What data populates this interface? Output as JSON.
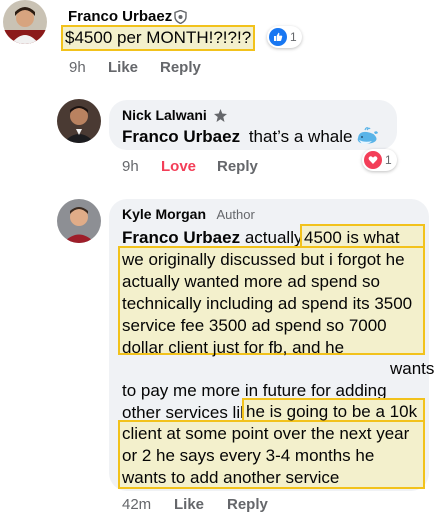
{
  "comments": [
    {
      "author": "Franco Urbaez",
      "text": "$4500 per MONTH!?!?!?",
      "reaction_count": "1",
      "time": "9h",
      "like_label": "Like",
      "reply_label": "Reply"
    },
    {
      "author": "Nick Lalwani",
      "mention": "Franco Urbaez",
      "text": "that’s a whale",
      "reaction_count": "1",
      "time": "9h",
      "like_label": "Love",
      "reply_label": "Reply"
    },
    {
      "author": "Kyle Morgan",
      "badge": "Author",
      "mention": "Franco Urbaez",
      "text_part1": "actually",
      "text_part2": "4500 is what we originally discussed but i forgot he actually wanted more ad spend so technically including ad spend its 3500 service fee 3500 ad spend so 7000 dollar client just for fb, and he",
      "text_part3": "wants to pay me more in future for adding other services like snapchat ads and stuff....",
      "text_part4": "he is going to be a 10k client at some point over the next year or 2 he says every 3-4 months he wants to add another service",
      "time": "42m",
      "like_label": "Like",
      "reply_label": "Reply"
    }
  ],
  "colors": {
    "like_blue": "#1877f2",
    "love_red": "#f33e58",
    "highlight_outline": "#f2c21b",
    "highlight_fill": "#f3f0cc"
  }
}
